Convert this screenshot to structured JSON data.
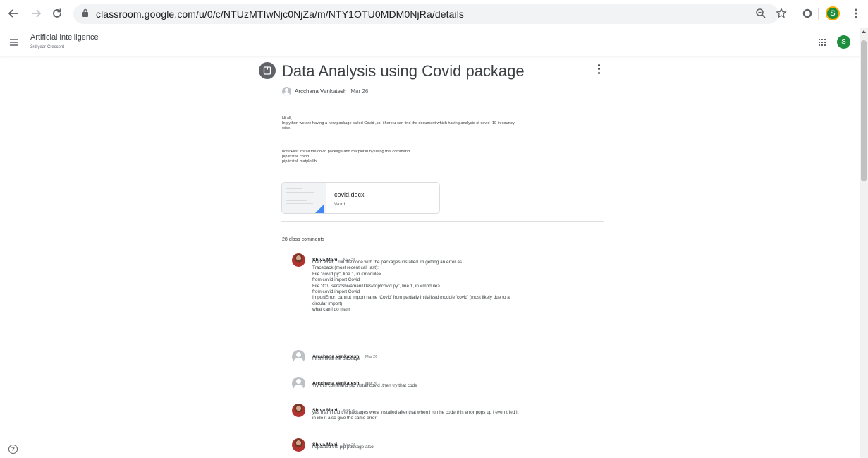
{
  "browser": {
    "url": "classroom.google.com/u/0/c/NTUzMTIwNjc0NjZa/m/NTY1OTU0MDM0NjRa/details",
    "profile_initial": "S"
  },
  "header": {
    "class_name": "Artificial intelligence",
    "section": "3rd year-Crescent",
    "account_initial": "S"
  },
  "post": {
    "title": "Data Analysis using Covid package",
    "author": "Arcchana Venkatesh",
    "date": "Mar 26",
    "body_lines": [
      "Hi all,",
      "In python we are having a new package called Covid ,so, i here u can find the document which having analysis of covid -19 in country",
      "wise."
    ],
    "note_lines": [
      "note:First install the covid package and matplotlib by using this command",
      "pip install covid",
      "pip install matplotlib"
    ],
    "attachment": {
      "name": "covid.docx",
      "type": "Word"
    }
  },
  "comments": {
    "count_label": "28 class comments",
    "items": [
      {
        "author": "Shiva Mani",
        "date": "Mar 26",
        "lines": [
          "mam when i run the code with the packages installed im getting an error as",
          "Traceback (most recent call last):",
          "File \"covid.py\", line 1, in <module>",
          "from covid import Covid",
          "File \"C:\\Users\\Shivamani\\Desktop\\covid.py\", line 1, in <module>",
          "from covid import Covid",
          "ImportError: cannot import name 'Covid' from partially initialized module 'covid' (most likely due to a",
          "circular import)",
          "what can i do mam"
        ]
      },
      {
        "author": "Arcchana Venkatesh",
        "date": "Mar 26",
        "lines": [
          "First install the package"
        ]
      },
      {
        "author": "Arcchana Venkatesh",
        "date": "Mar 26",
        "lines": [
          "Try this command pip install covid .then try that code"
        ]
      },
      {
        "author": "Shiva Mani",
        "date": "Mar 26",
        "lines": [
          "yes mam i did the packages were installed after that when i run he code this error pops up i even tried it",
          "in ide it also give the same error"
        ]
      },
      {
        "author": "Shiva Mani",
        "date": "Mar 26",
        "lines": [
          "i updated the pip package also"
        ]
      }
    ]
  },
  "help": {
    "symbol": "?"
  }
}
